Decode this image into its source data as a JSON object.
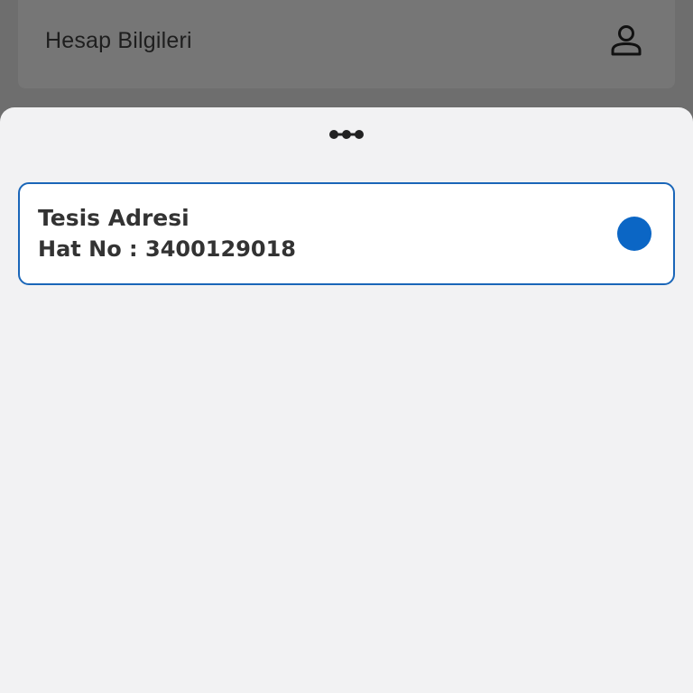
{
  "header": {
    "title": "Hesap Bilgileri",
    "icon": "user-icon"
  },
  "sheet": {
    "handle_icon": "drag-handle-icon",
    "items": [
      {
        "title": "Tesis Adresi",
        "line_label": "Hat No : 3400129018",
        "selected": true
      }
    ]
  },
  "colors": {
    "accent": "#0b66c5",
    "card_border": "#1a66b8",
    "sheet_bg": "#f2f2f3",
    "overlay_bg": "#6e6e6e"
  }
}
